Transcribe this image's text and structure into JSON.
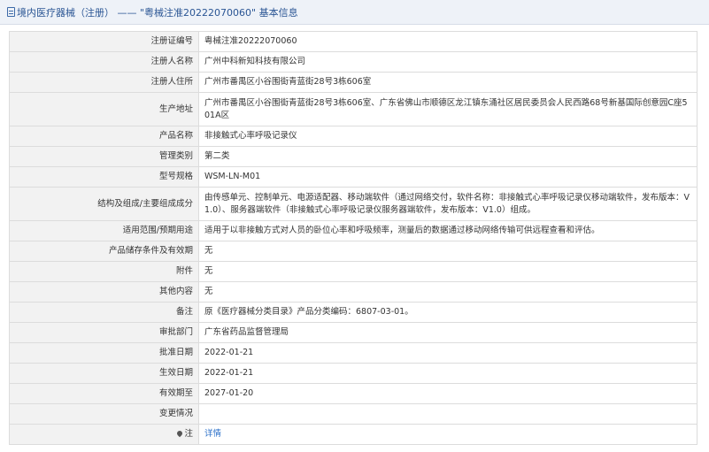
{
  "header": {
    "title": "境内医疗器械（注册） —— \"粤械注准20222070060\" 基本信息"
  },
  "rows": [
    {
      "label": "注册证编号",
      "value": "粤械注准20222070060"
    },
    {
      "label": "注册人名称",
      "value": "广州中科新知科技有限公司"
    },
    {
      "label": "注册人住所",
      "value": "广州市番禺区小谷围街青蓝街28号3栋606室"
    },
    {
      "label": "生产地址",
      "value": "广州市番禺区小谷围街青蓝街28号3栋606室、广东省佛山市顺德区龙江镇东涌社区居民委员会人民西路68号新基国际创意园C座501A区"
    },
    {
      "label": "产品名称",
      "value": "非接触式心率呼吸记录仪"
    },
    {
      "label": "管理类别",
      "value": "第二类"
    },
    {
      "label": "型号规格",
      "value": "WSM-LN-M01"
    },
    {
      "label": "结构及组成/主要组成成分",
      "value": "由传感单元、控制单元、电源适配器、移动端软件（通过网络交付，软件名称：非接触式心率呼吸记录仪移动端软件，发布版本：V1.0）、服务器端软件（非接触式心率呼吸记录仪服务器端软件，发布版本：V1.0）组成。"
    },
    {
      "label": "适用范围/预期用途",
      "value": "适用于以非接触方式对人员的卧位心率和呼吸频率，测量后的数据通过移动网络传输可供远程查看和评估。"
    },
    {
      "label": "产品储存条件及有效期",
      "value": "无"
    },
    {
      "label": "附件",
      "value": "无"
    },
    {
      "label": "其他内容",
      "value": "无"
    },
    {
      "label": "备注",
      "value": "原《医疗器械分类目录》产品分类编码：6807-03-01。"
    },
    {
      "label": "审批部门",
      "value": "广东省药品监督管理局"
    },
    {
      "label": "批准日期",
      "value": "2022-01-21"
    },
    {
      "label": "生效日期",
      "value": "2022-01-21"
    },
    {
      "label": "有效期至",
      "value": "2027-01-20"
    },
    {
      "label": "变更情况",
      "value": ""
    }
  ],
  "note_row": {
    "label": "注",
    "link_text": "详情",
    "icon": "pin-icon"
  }
}
